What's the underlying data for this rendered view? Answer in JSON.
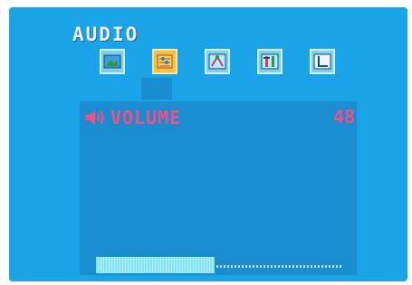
{
  "menu": {
    "title": "AUDIO",
    "tabs": [
      {
        "icon": "picture-icon",
        "active": false
      },
      {
        "icon": "audio-icon",
        "active": true
      },
      {
        "icon": "setup-icon",
        "active": false
      },
      {
        "icon": "tools-icon",
        "active": false
      },
      {
        "icon": "clock-icon",
        "active": false
      }
    ]
  },
  "volume": {
    "label": "VOLUME",
    "value": "48",
    "level_fraction": 0.48
  },
  "colors": {
    "background": "#1aa3e6",
    "panel": "#1a8cd0",
    "accent_text": "#f24f82",
    "active_tab": "#f3c23e"
  }
}
